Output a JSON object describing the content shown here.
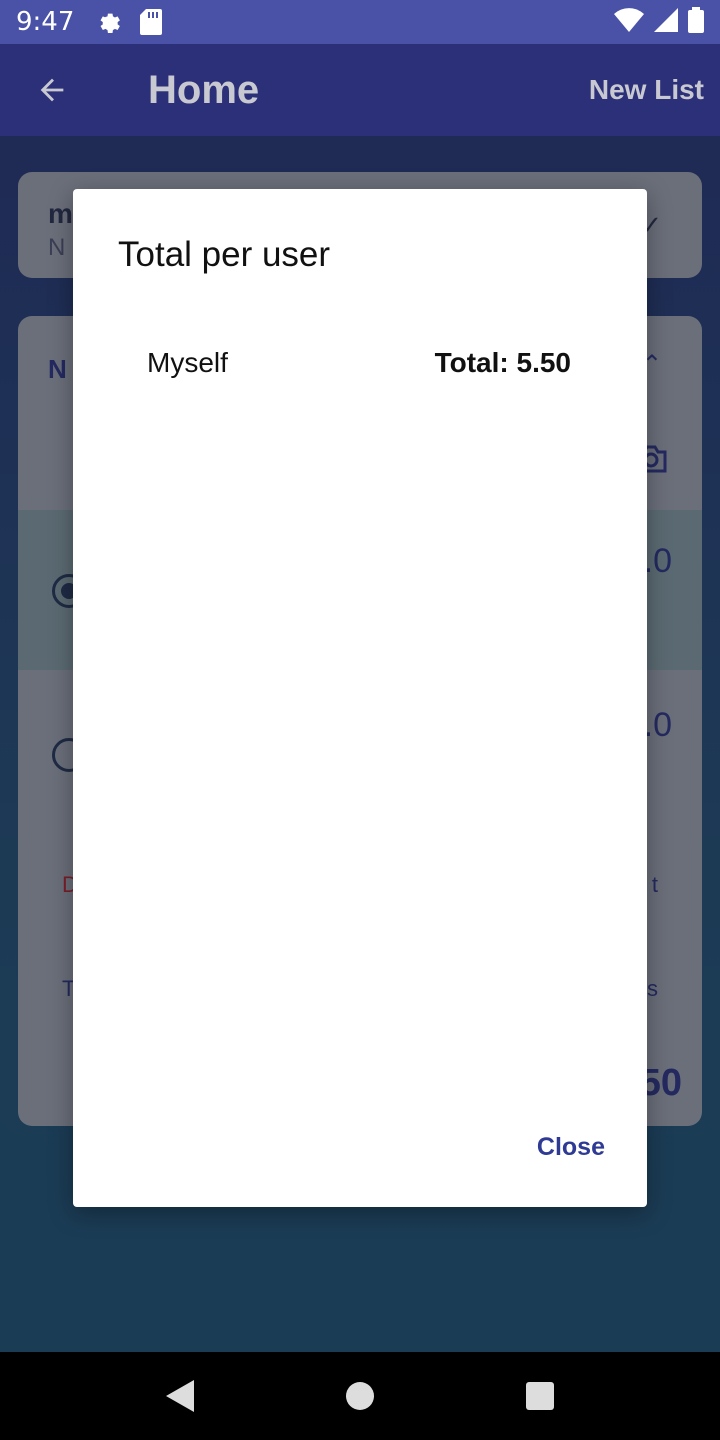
{
  "status_bar": {
    "time": "9:47",
    "icons": [
      "gear-icon",
      "sd-card-icon",
      "wifi-icon",
      "signal-icon",
      "battery-icon"
    ]
  },
  "app_bar": {
    "title": "Home",
    "action_label": "New List"
  },
  "background": {
    "list_card": {
      "title_fragment": "m",
      "subtitle_fragment": "N"
    },
    "items_card": {
      "header_fragment": "N",
      "row_amounts": [
        ".0",
        ".0"
      ],
      "red_fragment": "D",
      "blue_fragment": "T",
      "right_fragment_1": "t",
      "right_fragment_2": "s",
      "total_fragment": "50"
    }
  },
  "dialog": {
    "title": "Total per user",
    "users": [
      {
        "name": "Myself",
        "total": "Total: 5.50"
      }
    ],
    "close_label": "Close"
  },
  "colors": {
    "accent": "#2e3a93",
    "status_bar": "#4a52a8",
    "app_bar": "#2c3079"
  }
}
